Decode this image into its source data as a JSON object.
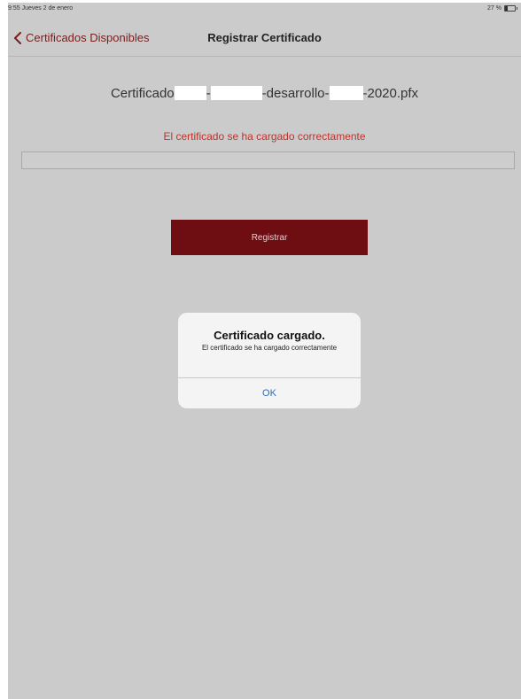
{
  "status_bar": {
    "time_date": "9:55  Jueves 2 de enero",
    "battery": "27 %"
  },
  "nav": {
    "back_label": "Certificados Disponibles",
    "title": "Registrar Certificado"
  },
  "file": {
    "part1": "Certificado",
    "part2": "-",
    "part3": "-desarrollo-",
    "part4": "-2020.pfx"
  },
  "status_message": "El certificado se ha cargado correctamente",
  "register_button": "Registrar",
  "alert": {
    "title": "Certificado cargado.",
    "message": "El certificado se ha cargado correctamente",
    "ok": "OK"
  },
  "colors": {
    "accent": "#6e0d12",
    "back_link": "#7a1d1d",
    "success_text": "#c1312a",
    "alert_button": "#2b6bc4",
    "background": "#cbcbcb"
  },
  "icons": {
    "back": "chevron-left-icon",
    "battery": "battery-icon"
  }
}
